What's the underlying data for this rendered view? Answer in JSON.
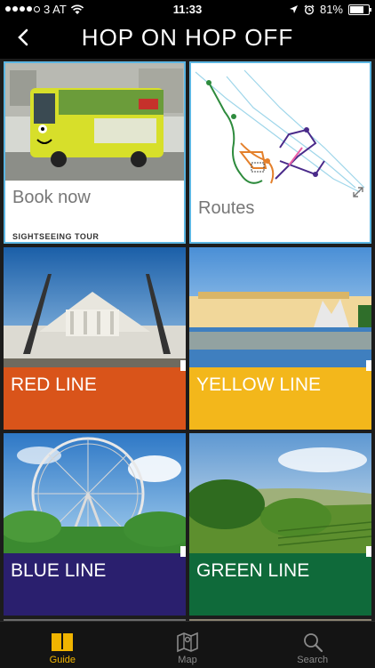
{
  "status_bar": {
    "carrier": "3 AT",
    "time": "11:33",
    "battery": "81%",
    "battery_level": 0.81
  },
  "nav": {
    "title": "HOP ON HOP OFF",
    "back_icon": "chevron-left-icon"
  },
  "tiles": {
    "book": {
      "label": "Book now",
      "sublabel": "SIGHTSEEING TOUR"
    },
    "routes": {
      "label": "Routes"
    },
    "red": {
      "label": "RED LINE",
      "color": "#d9541a"
    },
    "yellow": {
      "label": "YELLOW LINE",
      "color": "#f3b71b"
    },
    "blue": {
      "label": "BLUE LINE",
      "color": "#2a1f6e"
    },
    "green": {
      "label": "GREEN LINE",
      "color": "#0f6a3a"
    }
  },
  "tabbar": {
    "tabs": [
      {
        "label": "Guide",
        "icon": "book-icon",
        "active": true
      },
      {
        "label": "Map",
        "icon": "map-icon",
        "active": false
      },
      {
        "label": "Search",
        "icon": "search-icon",
        "active": false
      }
    ],
    "active_color": "#f0b400"
  }
}
